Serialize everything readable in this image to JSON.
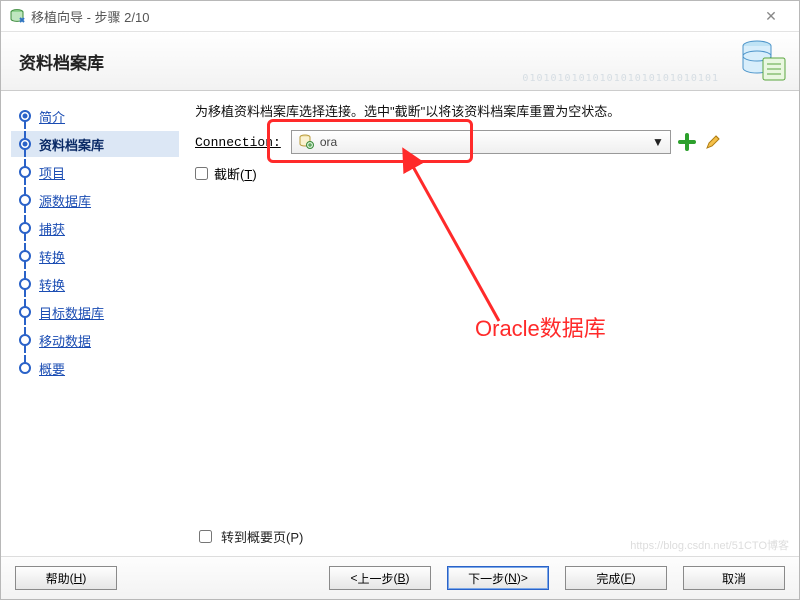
{
  "window": {
    "title": "移植向导 - 步骤 2/10"
  },
  "header": {
    "page_title": "资料档案库",
    "binary_deco": "0101010101010101010101010101"
  },
  "sidebar": {
    "items": [
      {
        "label": "简介"
      },
      {
        "label": "资料档案库"
      },
      {
        "label": "项目"
      },
      {
        "label": "源数据库"
      },
      {
        "label": "捕获"
      },
      {
        "label": "转换"
      },
      {
        "label": "转换"
      },
      {
        "label": "目标数据库"
      },
      {
        "label": "移动数据"
      },
      {
        "label": "概要"
      }
    ],
    "active_index": 1
  },
  "content": {
    "instruction": "为移植资料档案库选择连接。选中\"截断\"以将该资料档案库重置为空状态。",
    "connection_label": "Connection:",
    "connection_value": "ora",
    "truncate_label": "截断",
    "truncate_mn": "T",
    "goto_summary_label": "转到概要页",
    "goto_summary_mn": "P"
  },
  "annotation": {
    "label": "Oracle数据库"
  },
  "footer": {
    "help": {
      "label": "帮助",
      "mn": "H"
    },
    "back": {
      "label": "上一步",
      "mn": "B",
      "prefix": "< "
    },
    "next": {
      "label": "下一步",
      "mn": "N",
      "suffix": " >"
    },
    "finish": {
      "label": "完成",
      "mn": "F"
    },
    "cancel": {
      "label": "取消"
    }
  },
  "watermark": "https://blog.csdn.net/51CTO博客"
}
